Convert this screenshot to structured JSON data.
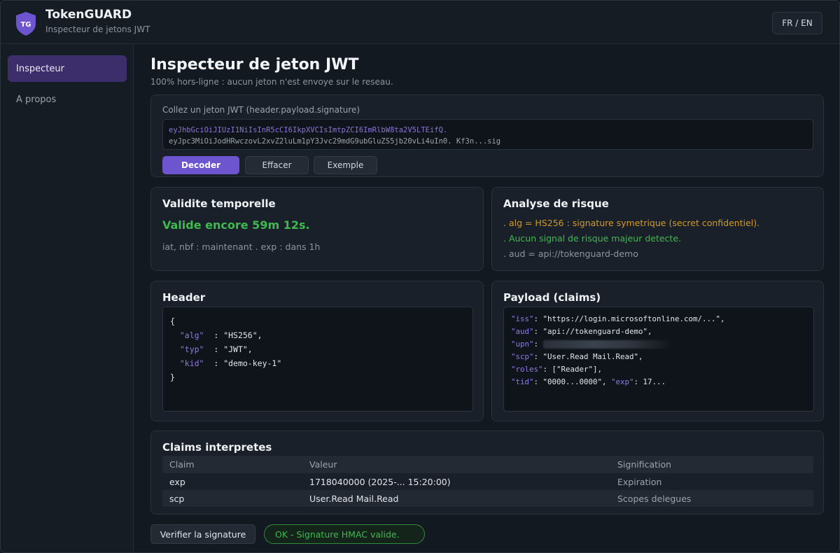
{
  "app": {
    "logo_text": "TG",
    "title": "TokenGUARD",
    "subtitle": "Inspecteur de jetons JWT",
    "language_toggle": "FR / EN",
    "accent_color": "#6d55cf"
  },
  "sidebar": {
    "items": [
      {
        "label": "Inspecteur",
        "active": true
      },
      {
        "label": "A propos",
        "active": false
      }
    ]
  },
  "main": {
    "title": "Inspecteur de jeton JWT",
    "subtitle": "100% hors-ligne : aucun jeton n'est envoye sur le reseau."
  },
  "input": {
    "label": "Collez un jeton JWT (header.payload.signature)",
    "token_line1": "eyJhbGciOiJIUzI1NiIsInR5cCI6IkpXVCIsImtpZCI6ImRlbW8ta2V5LTEifQ.",
    "token_line2": "eyJpc3MiOiJodHRwczovL2xvZ2luLm1pY3Jvc29mdG9ubGluZS5jb20vLi4uIn0. Kf3n...sig",
    "buttons": {
      "decode": "Decoder",
      "clear": "Effacer",
      "example": "Exemple"
    }
  },
  "validity": {
    "title": "Validite temporelle",
    "status": "Valide encore 59m 12s.",
    "detail": "iat, nbf : maintenant . exp : dans 1h"
  },
  "risk": {
    "title": "Analyse de risque",
    "items": [
      {
        "text": ". alg = HS256 : signature symetrique (secret confidentiel).",
        "level": "warning"
      },
      {
        "text": ". Aucun signal de risque majeur detecte.",
        "level": "ok"
      },
      {
        "text": ". aud = api://tokenguard-demo",
        "level": "info"
      }
    ]
  },
  "header_panel": {
    "title": "Header",
    "open_brace": "{",
    "close_brace": "}",
    "entries": [
      {
        "key": "\"alg\"",
        "value": ": \"HS256\","
      },
      {
        "key": "\"typ\"",
        "value": ": \"JWT\","
      },
      {
        "key": "\"kid\"",
        "value": ": \"demo-key-1\""
      }
    ]
  },
  "payload_panel": {
    "title": "Payload (claims)",
    "lines": [
      {
        "key": "\"iss\"",
        "value": ": \"https://login.microsoftonline.com/...\","
      },
      {
        "key": "\"aud\"",
        "value": ": \"api://tokenguard-demo\","
      },
      {
        "key": "\"upn\"",
        "value": ":"
      },
      {
        "key": "\"scp\"",
        "value": ": \"User.Read Mail.Read\","
      },
      {
        "key": "\"roles\"",
        "value": ": [\"Reader\"],"
      }
    ],
    "last_line": {
      "key1": "\"tid\"",
      "value1": ": \"0000...0000\", ",
      "key2": "\"exp\"",
      "value2": ": 17..."
    }
  },
  "claims_table": {
    "title": "Claims interpretes",
    "columns": [
      "Claim",
      "Valeur",
      "Signification"
    ],
    "rows": [
      {
        "claim": "exp",
        "value": "1718040000 (2025-... 15:20:00)",
        "meaning": "Expiration"
      },
      {
        "claim": "scp",
        "value": "User.Read Mail.Read",
        "meaning": "Scopes delegues"
      }
    ]
  },
  "signature": {
    "verify_button": "Verifier la signature",
    "result": "OK - Signature HMAC valide.",
    "result_color": "#3fb950"
  }
}
